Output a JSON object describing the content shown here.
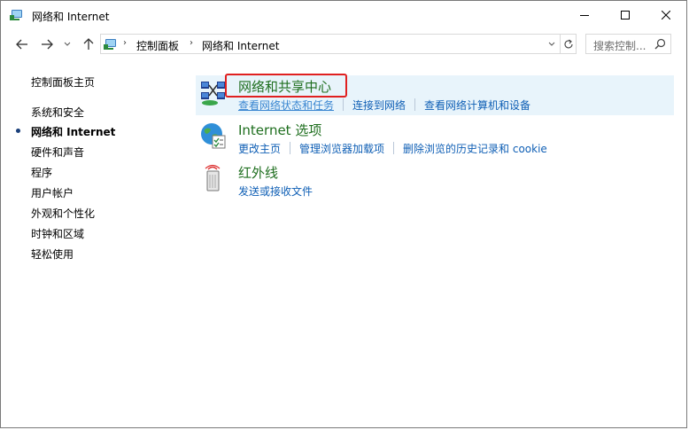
{
  "window": {
    "title": "网络和 Internet"
  },
  "address": {
    "crumbs": [
      "控制面板",
      "网络和 Internet"
    ]
  },
  "search": {
    "placeholder": "搜索控制..."
  },
  "sidebar": {
    "items": [
      {
        "label": "控制面板主页",
        "active": false
      },
      {
        "label": "系统和安全",
        "active": false
      },
      {
        "label": "网络和 Internet",
        "active": true
      },
      {
        "label": "硬件和声音",
        "active": false
      },
      {
        "label": "程序",
        "active": false
      },
      {
        "label": "用户帐户",
        "active": false
      },
      {
        "label": "外观和个性化",
        "active": false
      },
      {
        "label": "时钟和区域",
        "active": false
      },
      {
        "label": "轻松使用",
        "active": false
      }
    ]
  },
  "categories": [
    {
      "title": "网络和共享中心",
      "icon": "network-sharing-icon",
      "links": [
        "查看网络状态和任务",
        "连接到网络",
        "查看网络计算机和设备"
      ]
    },
    {
      "title": "Internet 选项",
      "icon": "internet-options-icon",
      "links": [
        "更改主页",
        "管理浏览器加载项",
        "删除浏览的历史记录和 cookie"
      ]
    },
    {
      "title": "红外线",
      "icon": "infrared-icon",
      "links": [
        "发送或接收文件"
      ]
    }
  ],
  "colors": {
    "category_title": "#1e6e1e",
    "link": "#0f5fb5",
    "hover_row": "#e8f4fb",
    "highlight_box": "#e02020"
  }
}
